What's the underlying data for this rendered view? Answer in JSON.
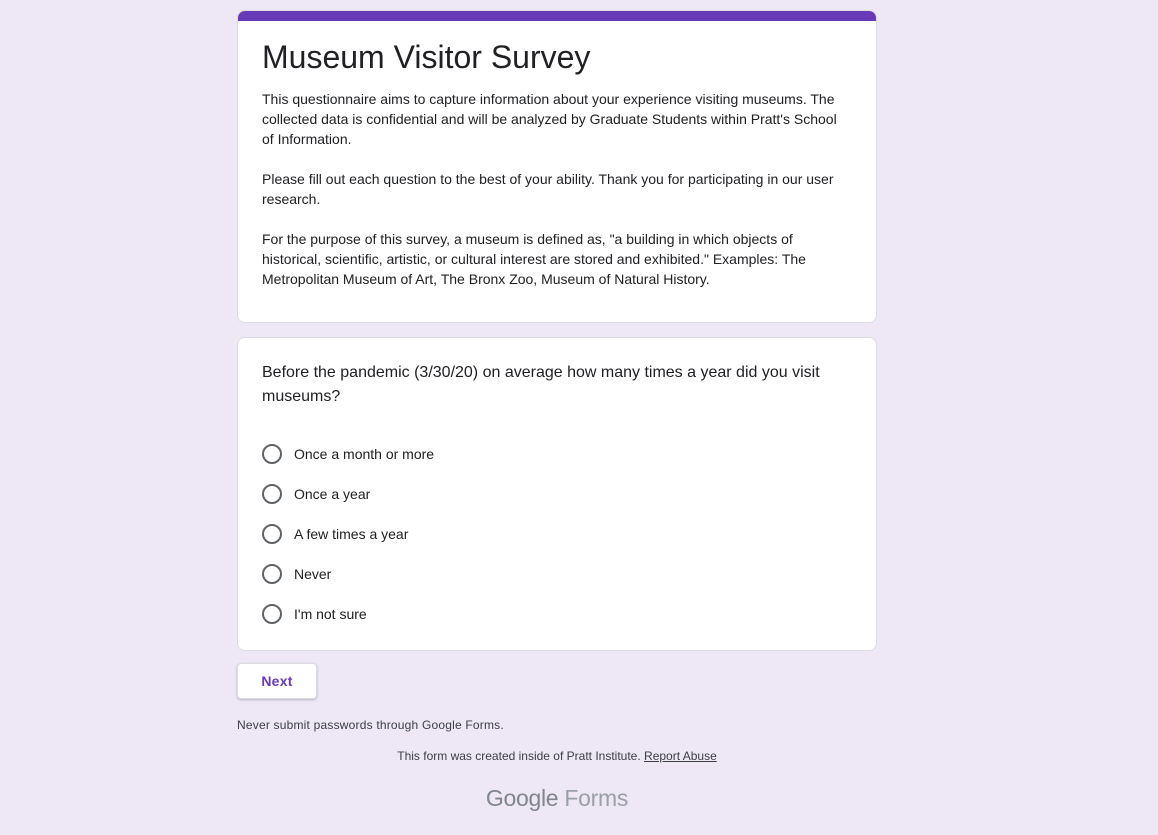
{
  "form": {
    "title": "Museum Visitor Survey",
    "description": [
      "This questionnaire aims to capture information about your experience visiting museums. The collected data is confidential and will be analyzed by Graduate Students within Pratt's School of Information.",
      "Please fill out each question to the best of your ability. Thank you for participating in our user research.",
      "For the purpose of this survey, a museum is defined as, \"a building in which objects of historical, scientific, artistic, or cultural interest are stored and exhibited.\" Examples: The Metropolitan Museum of Art, The Bronx Zoo, Museum of Natural History."
    ],
    "accent_color": "#673ab7",
    "background_color": "#ede7f6"
  },
  "question": {
    "title": "Before the pandemic (3/30/20) on average how many times a year did you visit museums?",
    "options": [
      "Once a month or more",
      "Once a year",
      "A few times a year",
      "Never",
      "I'm not sure"
    ]
  },
  "actions": {
    "next_label": "Next"
  },
  "footer": {
    "warning": "Never submit passwords through Google Forms.",
    "created_text": "This form was created inside of Pratt Institute.",
    "report_abuse": "Report Abuse",
    "logo_brand": "Google",
    "logo_product": "Forms"
  }
}
